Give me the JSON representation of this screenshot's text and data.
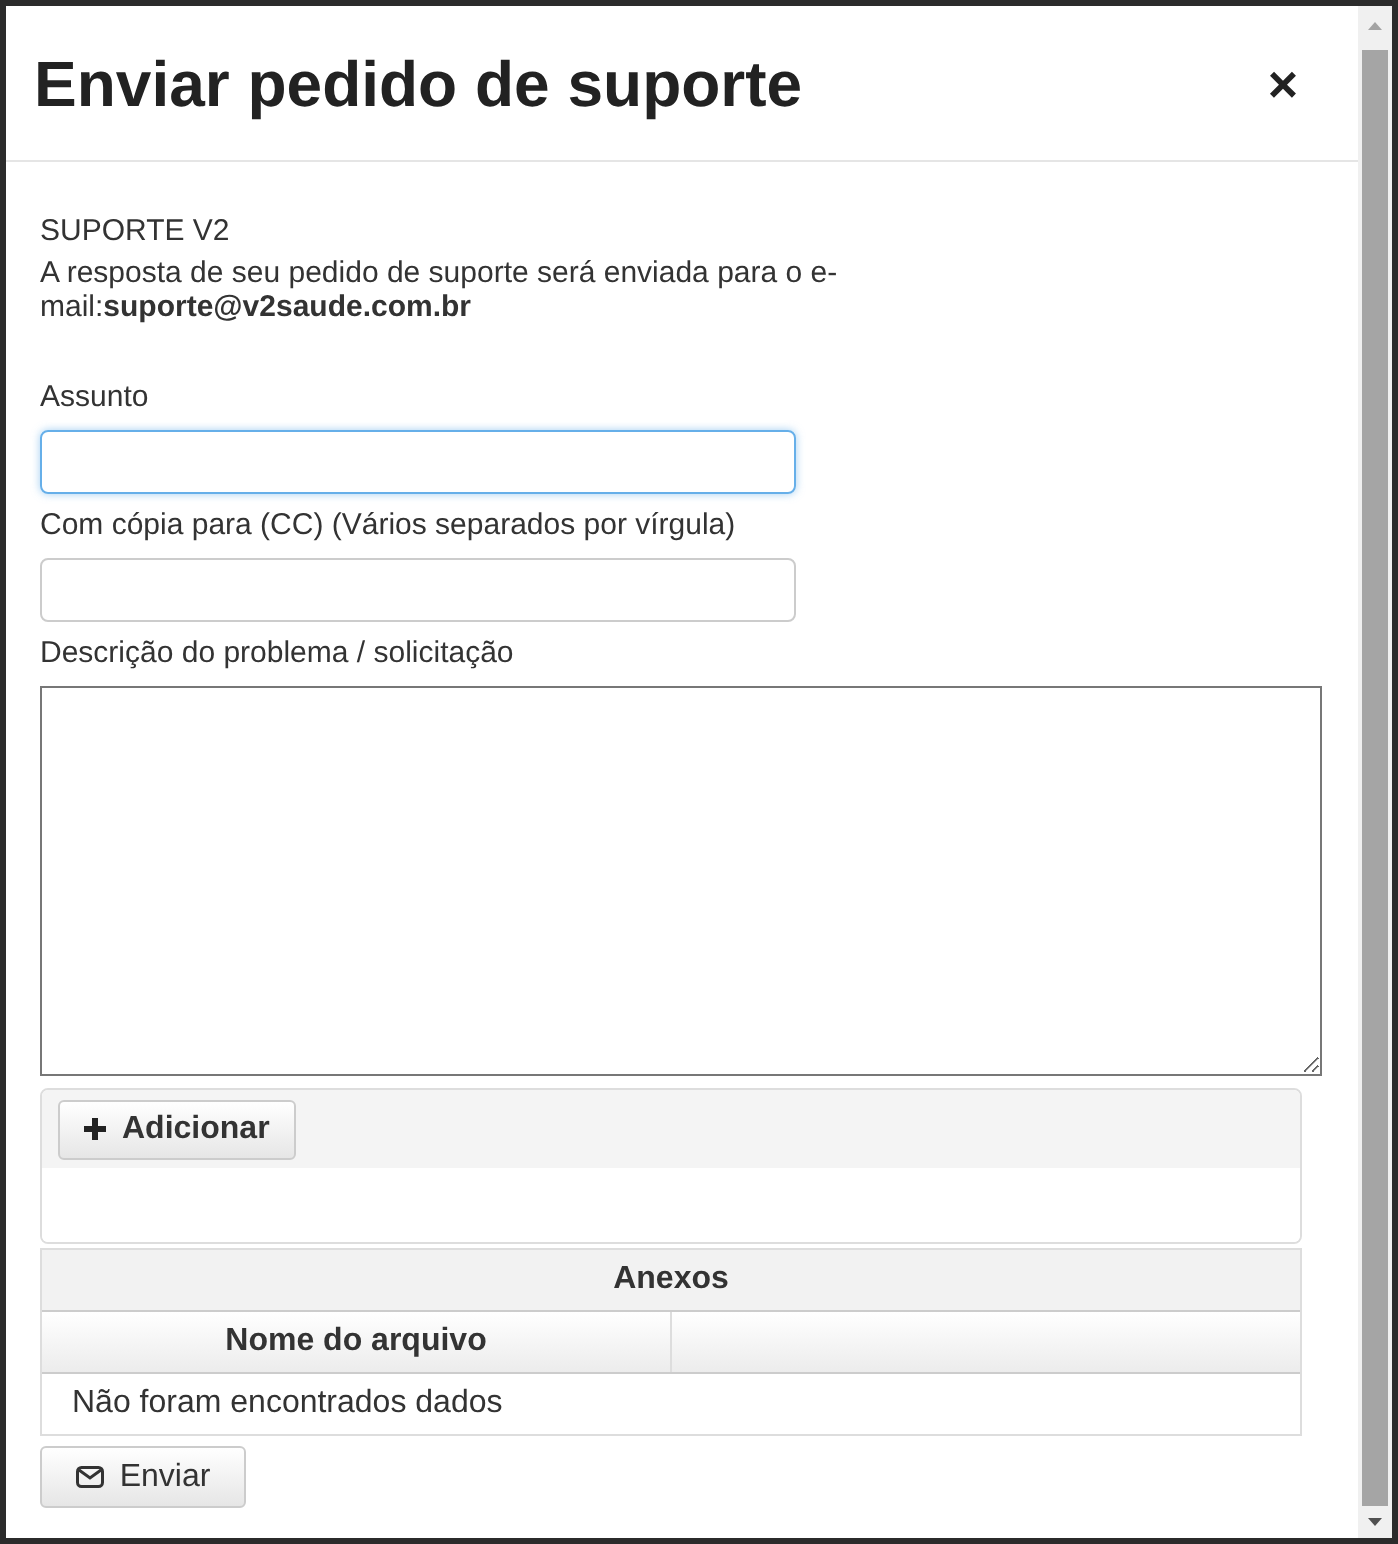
{
  "dialog": {
    "title": "Enviar pedido de suporte",
    "close": "×"
  },
  "intro": {
    "heading": "SUPORTE V2",
    "message": "A resposta de seu pedido de suporte será enviada para o e-mail:**suporte@v2saude.com.br**"
  },
  "fields": [
    {
      "kind": "input",
      "label": "Assunto",
      "focused": true
    },
    {
      "kind": "input",
      "label": "Com cópia para (CC) (Vários separados por vírgula)",
      "focused": false
    },
    {
      "kind": "textarea",
      "label": "Descrição do problema / solicitação",
      "focused": false
    }
  ],
  "attachments": {
    "add_button": "Adicionar"
  },
  "table": {
    "title": "Anexos",
    "columns": [
      "Nome do arquivo",
      ""
    ],
    "empty_message": "Não foram encontrados dados"
  },
  "submit_button": "Enviar"
}
